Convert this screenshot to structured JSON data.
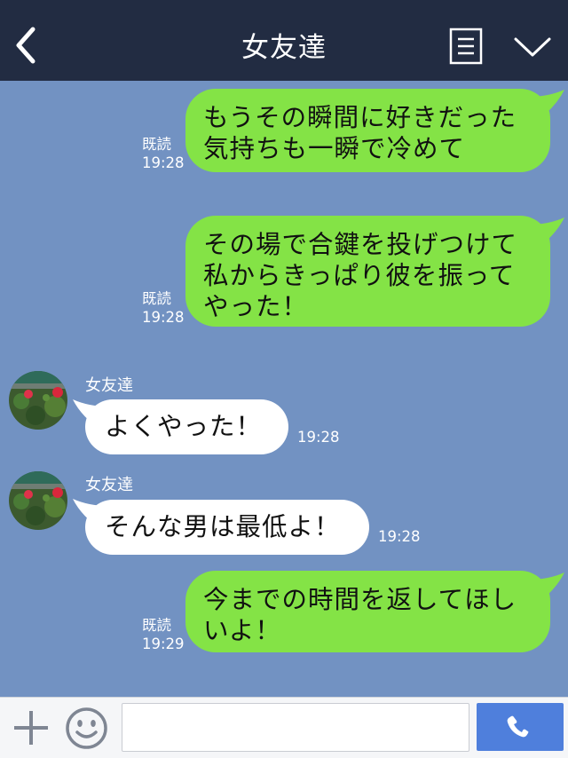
{
  "header": {
    "title": "女友達",
    "background": "#222c42"
  },
  "messages": [
    {
      "type": "sent",
      "text": "もうその瞬間に好きだった\n気持ちも一瞬で冷めて",
      "read": "既読",
      "time": "19:28"
    },
    {
      "type": "sent",
      "text": "その場で合鍵を投げつけて\n私からきっぱり彼を振って\nやった！",
      "read": "既読",
      "time": "19:28"
    },
    {
      "type": "received",
      "sender": "女友達",
      "text": "よくやった！",
      "time": "19:28"
    },
    {
      "type": "received",
      "sender": "女友達",
      "text": "そんな男は最低よ！",
      "time": "19:28"
    },
    {
      "type": "sent",
      "text": "今までの時間を返してほし\nいよ！",
      "read": "既読",
      "time": "19:29"
    }
  ],
  "input": {
    "value": "",
    "placeholder": ""
  },
  "icons": {
    "back": "chevron-left-icon",
    "menu": "menu-icon",
    "collapse": "chevron-down-icon",
    "plus": "plus-icon",
    "emoji": "smiley-icon",
    "call": "phone-icon"
  },
  "colors": {
    "chat_background": "#7292c2",
    "sent_bubble": "#84e346",
    "received_bubble": "#ffffff",
    "call_button": "#4f7fdc"
  }
}
